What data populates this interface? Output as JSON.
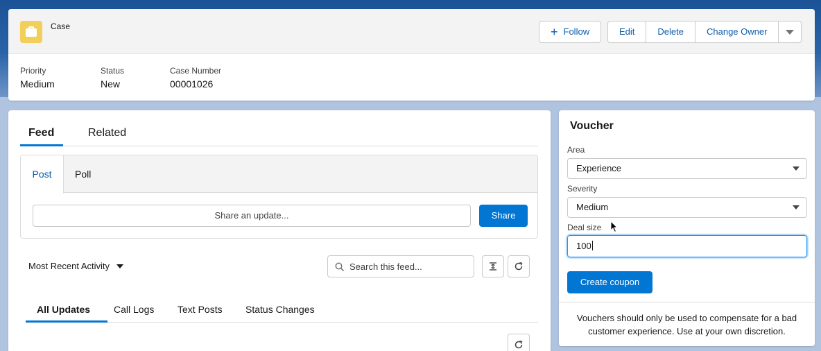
{
  "header": {
    "object_label": "Case",
    "actions": {
      "follow": "Follow",
      "edit": "Edit",
      "delete": "Delete",
      "change_owner": "Change Owner"
    },
    "fields": [
      {
        "label": "Priority",
        "value": "Medium"
      },
      {
        "label": "Status",
        "value": "New"
      },
      {
        "label": "Case Number",
        "value": "00001026"
      }
    ]
  },
  "feed": {
    "tabs": [
      "Feed",
      "Related"
    ],
    "publisher": {
      "tabs": [
        "Post",
        "Poll"
      ],
      "placeholder": "Share an update...",
      "share_label": "Share"
    },
    "sort_label": "Most Recent Activity",
    "search_placeholder": "Search this feed...",
    "filters": [
      "All Updates",
      "Call Logs",
      "Text Posts",
      "Status Changes"
    ]
  },
  "voucher": {
    "title": "Voucher",
    "area_label": "Area",
    "area_value": "Experience",
    "severity_label": "Severity",
    "severity_value": "Medium",
    "deal_label": "Deal size",
    "deal_value": "100",
    "button_label": "Create coupon",
    "footer": "Vouchers should only be used to compensate for a bad customer experience. Use at your own discretion."
  },
  "colors": {
    "brand": "#0176d3",
    "link": "#0b5cab",
    "case_icon": "#f2cf5b"
  }
}
